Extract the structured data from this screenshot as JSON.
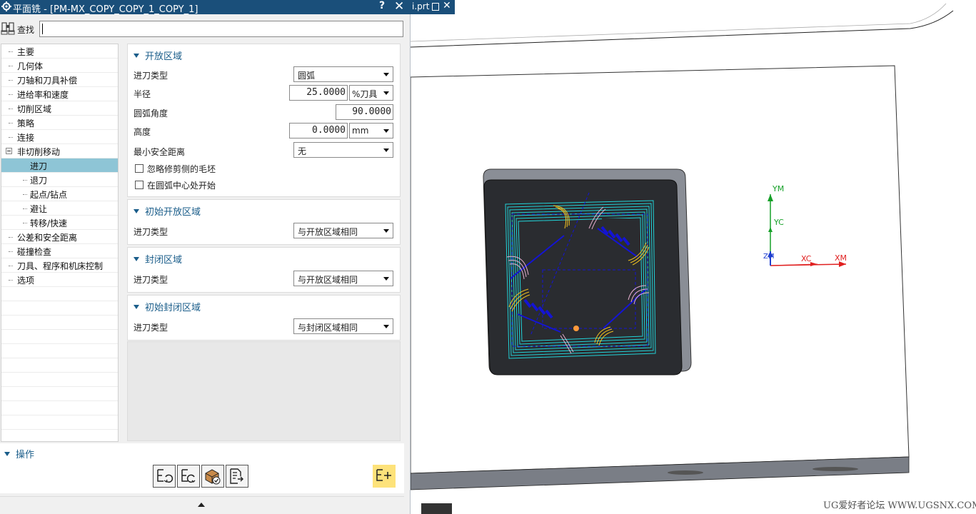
{
  "dialog": {
    "title": "平面铣 - [PM-MX_COPY_COPY_1_COPY_1]",
    "help_glyph": "?",
    "close_glyph": "✕",
    "search_label": "查找",
    "search_value": ""
  },
  "nav": {
    "items": [
      {
        "label": "主要"
      },
      {
        "label": "几何体"
      },
      {
        "label": "刀轴和刀具补偿"
      },
      {
        "label": "进给率和速度"
      },
      {
        "label": "切削区域"
      },
      {
        "label": "策略"
      },
      {
        "label": "连接"
      },
      {
        "label": "非切削移动"
      },
      {
        "label": "进刀"
      },
      {
        "label": "退刀"
      },
      {
        "label": "起点/钻点"
      },
      {
        "label": "避让"
      },
      {
        "label": "转移/快速"
      },
      {
        "label": "公差和安全距离"
      },
      {
        "label": "碰撞检查"
      },
      {
        "label": "刀具、程序和机床控制"
      },
      {
        "label": "选项"
      }
    ],
    "selected": "进刀"
  },
  "open_area": {
    "title": "开放区域",
    "entry_type_label": "进刀类型",
    "entry_type_value": "圆弧",
    "radius_label": "半径",
    "radius_value": "25.0000",
    "radius_unit": "%刀具",
    "arc_angle_label": "圆弧角度",
    "arc_angle_value": "90.0000",
    "height_label": "高度",
    "height_value": "0.0000",
    "height_unit": "mm",
    "min_clearance_label": "最小安全距离",
    "min_clearance_value": "无",
    "ignore_trim_label": "忽略修剪侧的毛坯",
    "ignore_trim_checked": false,
    "start_at_arc_center_label": "在圆弧中心处开始",
    "start_at_arc_center_checked": false
  },
  "initial_open_area": {
    "title": "初始开放区域",
    "entry_type_label": "进刀类型",
    "entry_type_value": "与开放区域相同"
  },
  "closed_area": {
    "title": "封闭区域",
    "entry_type_label": "进刀类型",
    "entry_type_value": "与开放区域相同"
  },
  "initial_closed_area": {
    "title": "初始封闭区域",
    "entry_type_label": "进刀类型",
    "entry_type_value": "与封闭区域相同"
  },
  "operations": {
    "title": "操作"
  },
  "viewport": {
    "tab_label": "i.prt",
    "tab_close_glyph": "✕",
    "axes": {
      "ym": "YM",
      "yc": "YC",
      "zm": "ZM",
      "xc": "XC",
      "xm": "XM"
    },
    "watermark": "UG爱好者论坛 WWW.UGSNX.COM"
  },
  "colors": {
    "title_bar": "#1a4f7a",
    "group_header": "#1a5d8a",
    "nav_selected": "#8ec5d6",
    "toolpath_cyan": "#22d3d8",
    "toolpath_blue": "#1414d4",
    "toolpath_yellow": "#f0c020",
    "toolpath_pink": "#e8b0d0",
    "pocket_dark": "#2a2c30",
    "block_gray": "#8a8e96"
  }
}
